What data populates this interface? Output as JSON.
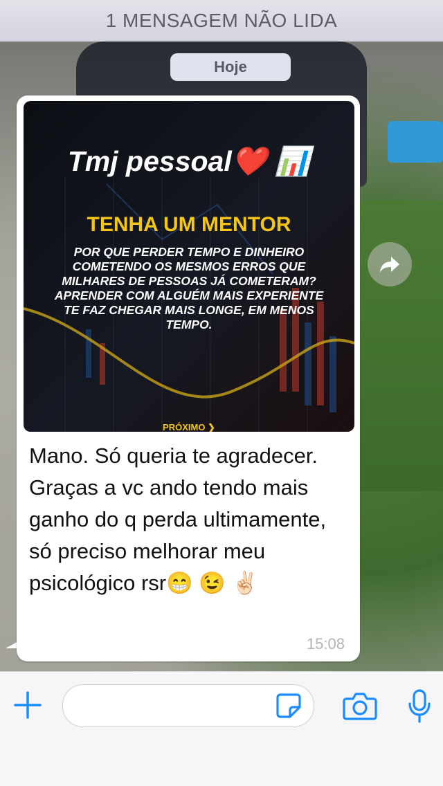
{
  "banner": {
    "unread_label": "1 MENSAGEM NÃO LIDA"
  },
  "chat": {
    "date_label": "Hoje",
    "message": {
      "media": {
        "caption_top": "Tmj pessoal❤️ 📊",
        "heading": "TENHA UM MENTOR",
        "body": "Por que perder tempo e dinheiro cometendo os mesmos erros que milhares de pessoas já cometeram? Aprender com alguém mais experiente te faz chegar mais longe, em menos tempo.",
        "next_label": "PRÓXIMO ❯"
      },
      "text": "Mano. Só queria te agradecer.  Graças a vc ando tendo mais ganho do q perda ultimamente, só preciso melhorar meu psicológico rsr😁 😉 ✌🏻",
      "time": "15:08"
    }
  },
  "input_bar": {
    "placeholder": "",
    "icons": [
      "plus-icon",
      "sticker-icon",
      "camera-icon",
      "mic-icon"
    ],
    "accent_color": "#1a8cff"
  },
  "forward": {
    "icon": "forward-arrow-icon"
  }
}
